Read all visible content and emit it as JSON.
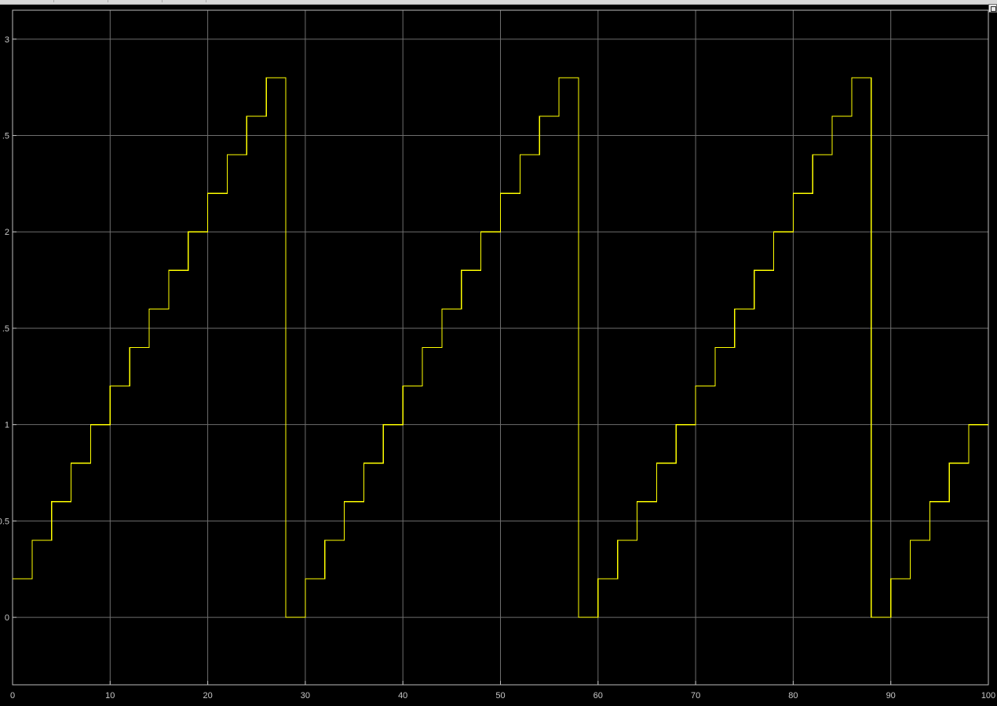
{
  "colors": {
    "background": "#000000",
    "grid": "#6e6e6e",
    "axes_border": "#bdbdbd",
    "signal": "#ffff00",
    "tick_text": "#c8c8c8"
  },
  "ui": {
    "expand_icon": "expand-icon"
  },
  "chart_data": {
    "type": "line",
    "title": "",
    "xlabel": "",
    "ylabel": "",
    "xlim": [
      0,
      100
    ],
    "ylim": [
      -0.35,
      3.15
    ],
    "grid": true,
    "legend": "none",
    "x_ticks": [
      0,
      10,
      20,
      30,
      40,
      50,
      60,
      70,
      80,
      90,
      100
    ],
    "x_tick_labels": [
      "0",
      "10",
      "20",
      "30",
      "40",
      "50",
      "60",
      "70",
      "80",
      "90",
      "100"
    ],
    "y_ticks": [
      0,
      0.5,
      1,
      1.5,
      2,
      2.5,
      3
    ],
    "y_tick_labels": [
      "0",
      "0.5",
      "1",
      ".5",
      "2",
      ".5",
      "3"
    ],
    "series": [
      {
        "line_style": "step",
        "x": [
          0,
          2,
          4,
          6,
          8,
          10,
          12,
          14,
          16,
          18,
          20,
          22,
          24,
          26,
          28,
          30,
          32,
          34,
          36,
          38,
          40,
          42,
          44,
          46,
          48,
          50,
          52,
          54,
          56,
          58,
          60,
          62,
          64,
          66,
          68,
          70,
          72,
          74,
          76,
          78,
          80,
          82,
          84,
          86,
          88,
          90,
          92,
          94,
          96,
          98,
          100
        ],
        "y": [
          0.2,
          0.4,
          0.6,
          0.8,
          1.0,
          1.2,
          1.4,
          1.6,
          1.8,
          2.0,
          2.2,
          2.4,
          2.6,
          2.8,
          0.0,
          0.2,
          0.4,
          0.6,
          0.8,
          1.0,
          1.2,
          1.4,
          1.6,
          1.8,
          2.0,
          2.2,
          2.4,
          2.6,
          2.8,
          0.0,
          0.2,
          0.4,
          0.6,
          0.8,
          1.0,
          1.2,
          1.4,
          1.6,
          1.8,
          2.0,
          2.2,
          2.4,
          2.6,
          2.8,
          0.0,
          0.2,
          0.4,
          0.6,
          0.8,
          1.0,
          1.0
        ]
      }
    ]
  }
}
